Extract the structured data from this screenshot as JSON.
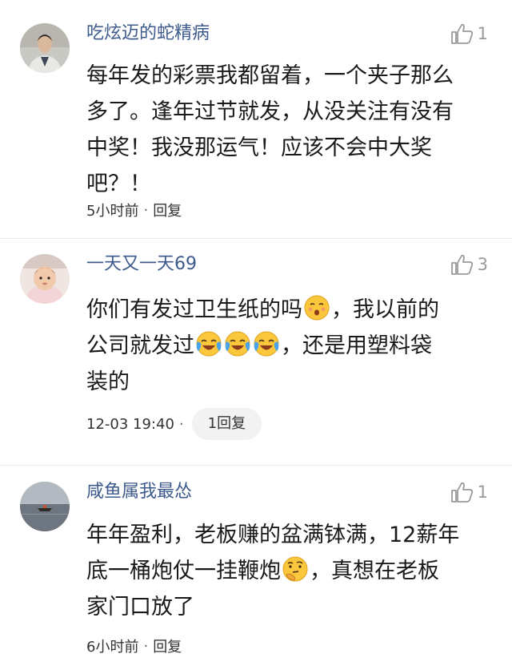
{
  "comments": [
    {
      "username": "吃炫迈的蛇精病",
      "like_count": "1",
      "lines": [
        "每年发的彩票我都留着，一个夹子那么",
        "多了。逢年过节就发，从没关注有没有",
        "中奖！我没那运气！应该不会中大奖",
        "吧？！"
      ],
      "time": "5小时前",
      "separator": "·",
      "reply_label": "回复"
    },
    {
      "username": "一天又一天69",
      "like_count": "3",
      "line1_a": "你们有发过卫生纸的吗",
      "line1_b": "，我以前的",
      "line2_a": "公司就发过",
      "line2_b": "，还是用塑料袋",
      "line3": "装的",
      "time": "12-03 19:40",
      "separator": "·",
      "reply_label": "1回复"
    },
    {
      "username": "咸鱼属我最怂",
      "like_count": "1",
      "line1": "年年盈利，老板赚的盆满钵满，12薪年",
      "line2_a": "底一桶炮仗一挂鞭炮",
      "line2_b": "，真想在老板",
      "line3": "家门口放了",
      "time": "6小时前",
      "separator": "·",
      "reply_label": "回复"
    }
  ],
  "icons": {
    "like": "thumbs-up-icon",
    "emoji_kiss": "kissing-face-emoji",
    "emoji_cry": "crying-laughing-emoji",
    "emoji_think": "thinking-face-emoji"
  },
  "colors": {
    "username": "#3d5a8c",
    "like": "#9a9a9a",
    "text": "#1a1a1a"
  }
}
